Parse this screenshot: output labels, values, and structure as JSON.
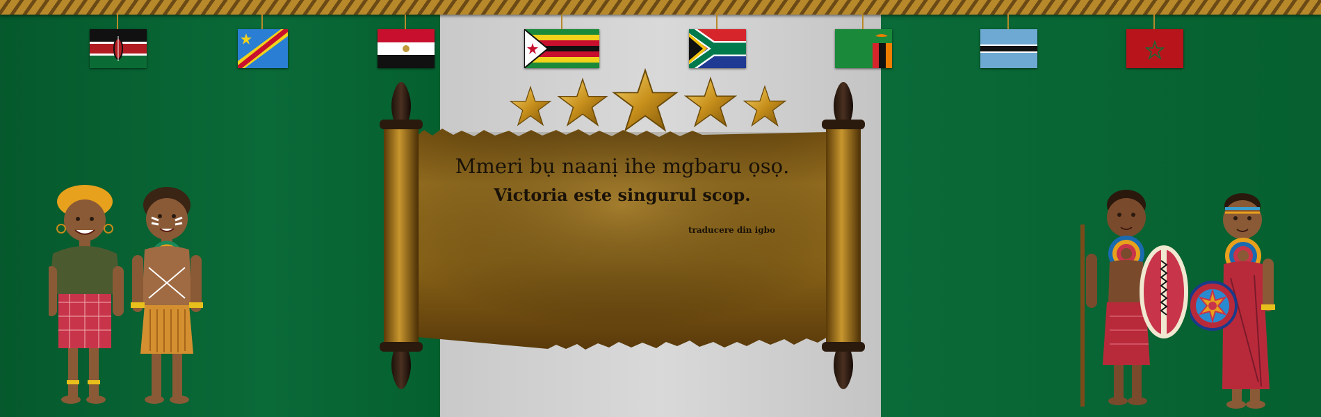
{
  "quote": {
    "igbo": "Mmeri bụ naanị ihe mgbaru ọsọ.",
    "romanian": "Victoria este singurul scop.",
    "attribution": "traducere din igbo"
  },
  "flags": [
    "kenya-flag",
    "dr-congo-flag",
    "egypt-flag",
    "zimbabwe-flag",
    "south-africa-flag",
    "zambia-flag",
    "botswana-flag",
    "morocco-flag"
  ],
  "stars_count": 5,
  "colors": {
    "green": "#0a6a38",
    "white": "#d3d3d3",
    "gold": "#b8892a",
    "parchment": "#8a6418"
  }
}
